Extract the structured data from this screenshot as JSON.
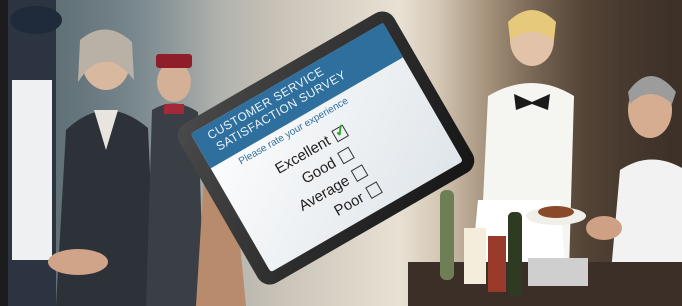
{
  "survey": {
    "header_line1": "CUSTOMER SERVICE",
    "header_line2": "SATISFACTION SURVEY",
    "subtitle": "Please rate your experience",
    "options": [
      {
        "label": "Excellent",
        "checked": true
      },
      {
        "label": "Good",
        "checked": false
      },
      {
        "label": "Average",
        "checked": false
      },
      {
        "label": "Poor",
        "checked": false
      }
    ]
  },
  "colors": {
    "header_band": "#2f6f9e",
    "checkmark": "#2fa52f",
    "screen": "#f4f6f8",
    "tablet_body": "#2a2a2a"
  }
}
